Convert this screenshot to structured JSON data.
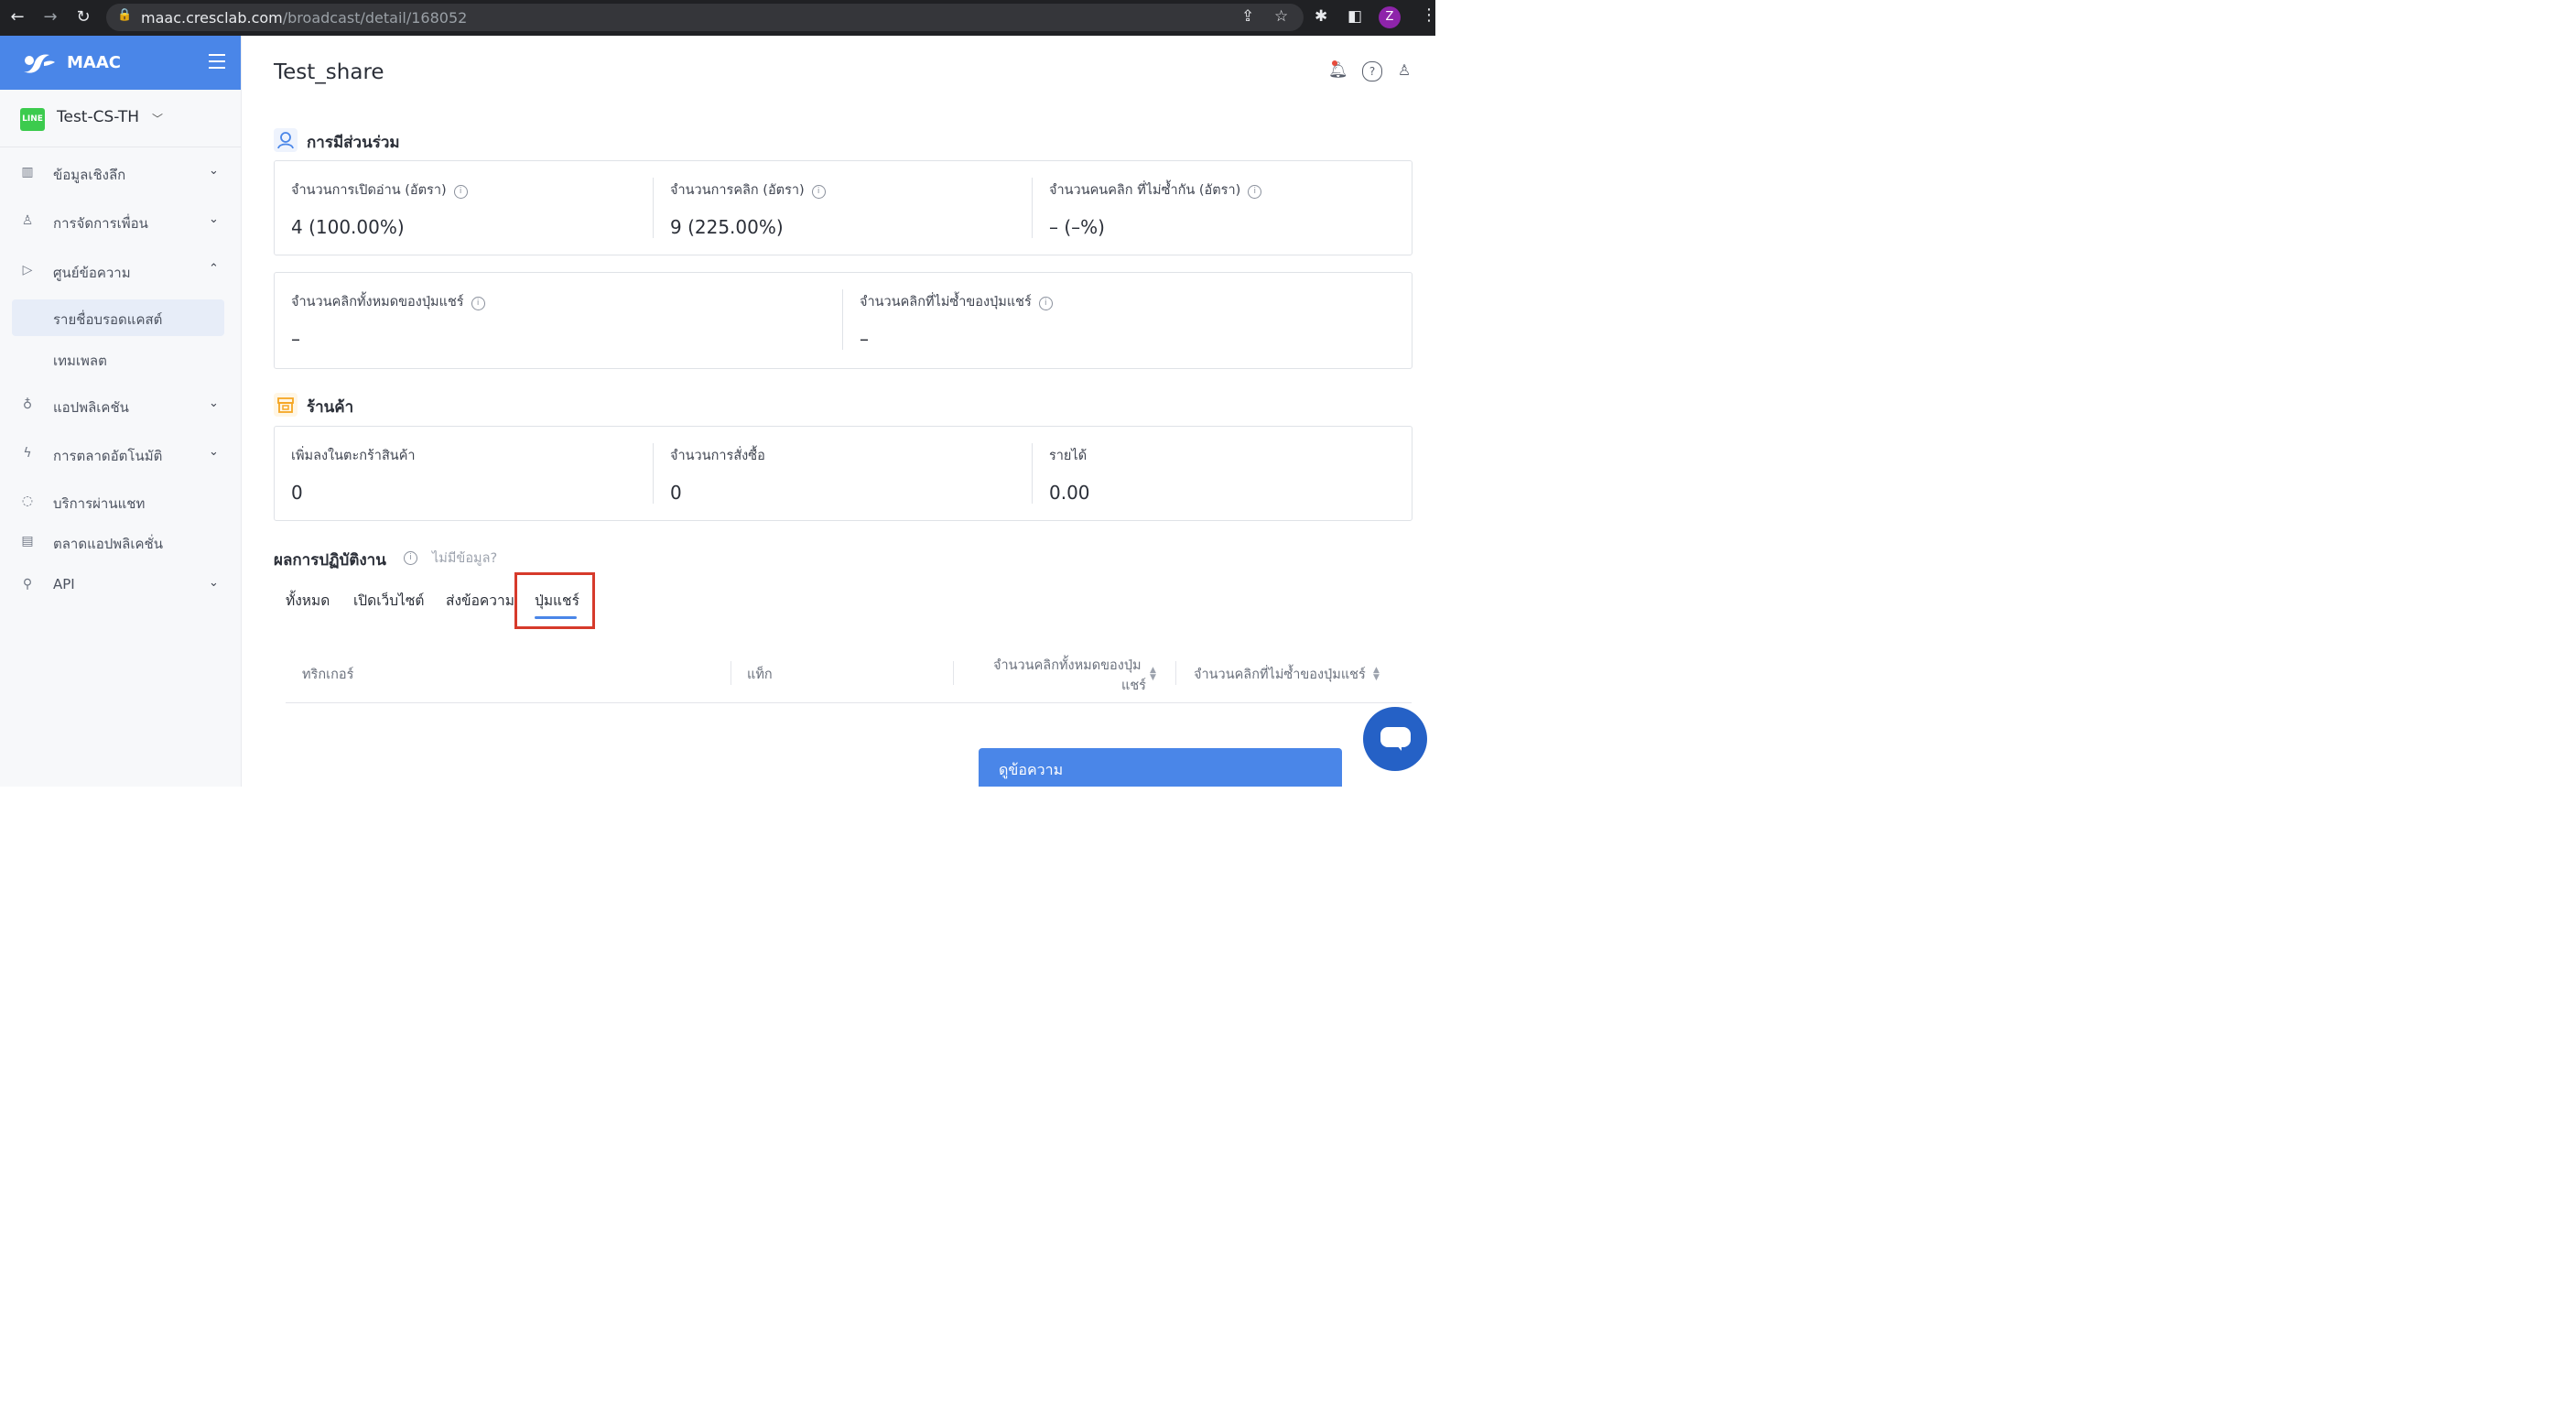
{
  "browser": {
    "url_domain": "maac.cresclab.com",
    "url_path": "/broadcast/detail/168052",
    "profile_initial": "Z"
  },
  "sidebar": {
    "brand": "MAAC",
    "account_badge": "LINE",
    "account_name": "Test-CS-TH",
    "items": [
      {
        "label": "ข้อมูลเชิงลึก",
        "icon": "chart-icon",
        "expandable": true
      },
      {
        "label": "การจัดการเพื่อน",
        "icon": "person-icon",
        "expandable": true
      },
      {
        "label": "ศูนย์ข้อความ",
        "icon": "send-icon",
        "expandable": true,
        "expanded": true
      },
      {
        "label": "แอปพลิเคชัน",
        "icon": "rocket-icon",
        "expandable": true
      },
      {
        "label": "การตลาดอัตโนมัติ",
        "icon": "lightning-icon",
        "expandable": true
      },
      {
        "label": "บริการผ่านแชท",
        "icon": "chat-icon",
        "expandable": false
      },
      {
        "label": "ตลาดแอปพลิเคชั่น",
        "icon": "store-icon",
        "expandable": false
      },
      {
        "label": "API",
        "icon": "plug-icon",
        "expandable": true
      }
    ],
    "subitems": [
      {
        "label": "รายชื่อบรอดแคสต์",
        "active": true
      },
      {
        "label": "เทมเพลต",
        "active": false
      }
    ]
  },
  "main": {
    "title": "Test_share",
    "engagement": {
      "title": "การมีส่วนร่วม",
      "metrics": [
        {
          "label": "จำนวนการเปิดอ่าน (อัตรา)",
          "value": "4 (100.00%)"
        },
        {
          "label": "จำนวนการคลิก (อัตรา)",
          "value": "9 (225.00%)"
        },
        {
          "label": "จำนวนคนคลิก ที่ไม่ซ้ำกัน (อัตรา)",
          "value": "– (–%)"
        }
      ],
      "share_metrics": [
        {
          "label": "จำนวนคลิกทั้งหมดของปุ่มแชร์",
          "value": "–"
        },
        {
          "label": "จำนวนคลิกที่ไม่ซ้ำของปุ่มแชร์",
          "value": "–"
        }
      ]
    },
    "shop": {
      "title": "ร้านค้า",
      "metrics": [
        {
          "label": "เพิ่มลงในตะกร้าสินค้า",
          "value": "0"
        },
        {
          "label": "จำนวนการสั่งซื้อ",
          "value": "0"
        },
        {
          "label": "รายได้",
          "value": "0.00"
        }
      ]
    },
    "performance": {
      "title": "ผลการปฏิบัติงาน",
      "no_data": "ไม่มีข้อมูล?",
      "tabs": [
        "ทั้งหมด",
        "เปิดเว็บไซต์",
        "ส่งข้อความ",
        "ปุ่มแชร์"
      ],
      "active_tab": 3,
      "columns": [
        "ทริกเกอร์",
        "แท็ก",
        "จำนวนคลิกทั้งหมดของปุ่ม",
        "แชร์",
        "จำนวนคลิกที่ไม่ซ้ำของปุ่มแชร์"
      ]
    },
    "view_message": "ดูข้อความ"
  },
  "colors": {
    "brand_blue": "#4a86e8",
    "highlight_red": "#d63a2b",
    "line_green": "#3ccb4e"
  }
}
